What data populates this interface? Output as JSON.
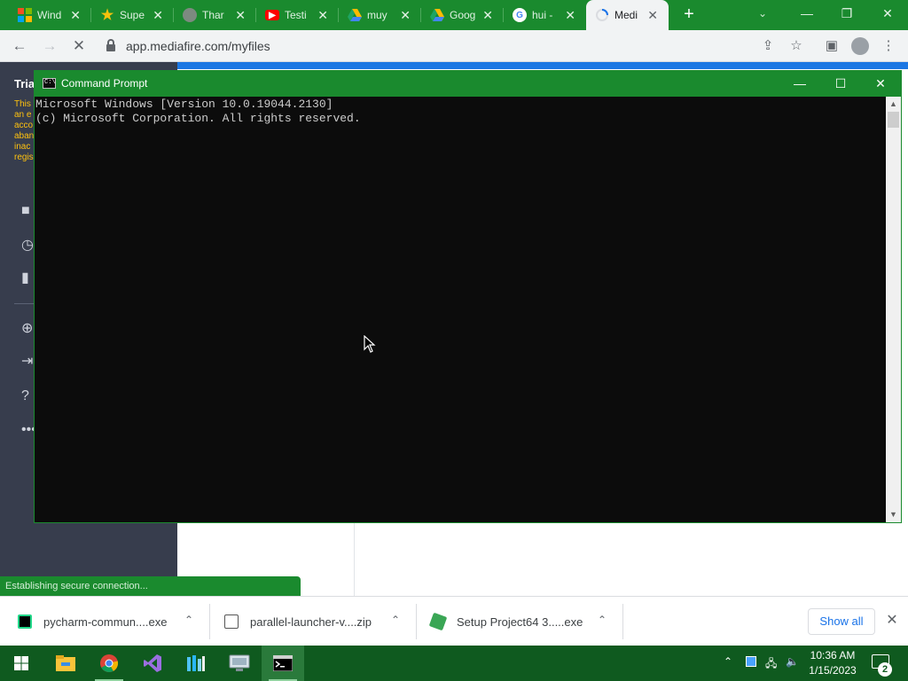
{
  "browser": {
    "tabs": [
      {
        "title": "Wind",
        "favicon": "windows-logo-icon",
        "color": "#f25022"
      },
      {
        "title": "Supe",
        "favicon": "star-icon",
        "color": "#1f4e9c"
      },
      {
        "title": "Thar",
        "favicon": "globe-icon",
        "color": "#7d8a80"
      },
      {
        "title": "Testi",
        "favicon": "youtube-icon",
        "color": "#ff0000"
      },
      {
        "title": "muy",
        "favicon": "google-drive-icon",
        "color": "#1fa463"
      },
      {
        "title": "Goog",
        "favicon": "google-drive-icon",
        "color": "#1fa463"
      },
      {
        "title": "hui -",
        "favicon": "google-icon",
        "color": "#ffffff"
      },
      {
        "title": "Medi",
        "favicon": "chrome-loading-icon",
        "color": "#1a73e8"
      }
    ],
    "active_tab": 7,
    "url": "app.mediafire.com/myfiles",
    "status_text": "Establishing secure connection..."
  },
  "mediafire": {
    "sidebar_title": "Tria",
    "notice_lines": [
      "This",
      "an e",
      "acco",
      "aban",
      "inac",
      "regis"
    ]
  },
  "cmd": {
    "title": "Command Prompt",
    "icon_text": "C:\\",
    "lines": [
      "Microsoft Windows [Version 10.0.19044.2130]",
      "(c) Microsoft Corporation. All rights reserved."
    ]
  },
  "downloads": {
    "items": [
      {
        "name": "pycharm-commun....exe",
        "icon": "pycharm-icon"
      },
      {
        "name": "parallel-launcher-v....zip",
        "icon": "zip-archive-icon"
      },
      {
        "name": "Setup Project64 3.....exe",
        "icon": "installer-icon"
      }
    ],
    "show_all_label": "Show all"
  },
  "taskbar": {
    "time": "10:36 AM",
    "date": "1/15/2023",
    "notification_count": "2"
  }
}
